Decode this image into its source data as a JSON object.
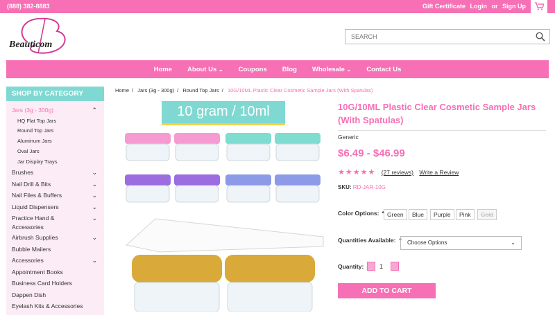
{
  "topbar": {
    "phone": "(888) 382-8883",
    "gift": "Gift Certificate",
    "login": "Login",
    "or": "or",
    "signup": "Sign Up",
    "cart_icon": "cart-icon"
  },
  "logo": {
    "initial": "B",
    "text": "Beauticom"
  },
  "search": {
    "placeholder": "SEARCH"
  },
  "nav": {
    "home": "Home",
    "about": "About Us",
    "coupons": "Coupons",
    "blog": "Blog",
    "wholesale": "Wholesale",
    "contact": "Contact Us"
  },
  "sidebar": {
    "heading": "SHOP BY CATEGORY",
    "jars": "Jars (3g - 300g)",
    "sub": [
      "HQ Flat Top Jars",
      "Round Top Jars",
      "Aluminum Jars",
      "Oval Jars",
      "Jar Display Trays"
    ],
    "items": [
      "Brushes",
      "Nail Drill & Bits",
      "Nail Files & Buffers",
      "Liquid Dispensers",
      "Practice Hand & Accessories",
      "Airbrush Supplies",
      "Bubble Mailers",
      "Accessories",
      "Appointment Books",
      "Business Card Holders",
      "Dappen Dish",
      "Eyelash Kits & Accessories"
    ]
  },
  "breadcrumb": [
    "Home",
    "Jars (3g - 300g)",
    "Round Top Jars",
    "10G/10ML Plastic Clear Cosmetic Sample Jars (With Spatulas)"
  ],
  "image": {
    "banner": "10 gram / 10ml"
  },
  "product": {
    "title": "10G/10ML Plastic Clear Cosmetic Sample Jars (With Spatulas)",
    "brand": "Generic",
    "price": "$6.49 - $46.99",
    "stars": "★★★★★",
    "reviews": "(27 reviews)",
    "write_review": "Write a Review",
    "sku_label": "SKU:",
    "sku": "RD-JAR-10G",
    "color_label": "Color Options:",
    "required": "*",
    "colors": [
      "Green",
      "Blue",
      "Purple",
      "Pink",
      "Gold"
    ],
    "qty_avail_label": "Quantities Available:",
    "qty_select": "Choose Options",
    "qty_label": "Quantity:",
    "qty_value": "1",
    "add_to_cart": "ADD TO CART"
  },
  "colors": {
    "accent": "#f76fb4",
    "teal": "#7fd9d2",
    "sidebar_bg": "#fcecf5"
  }
}
